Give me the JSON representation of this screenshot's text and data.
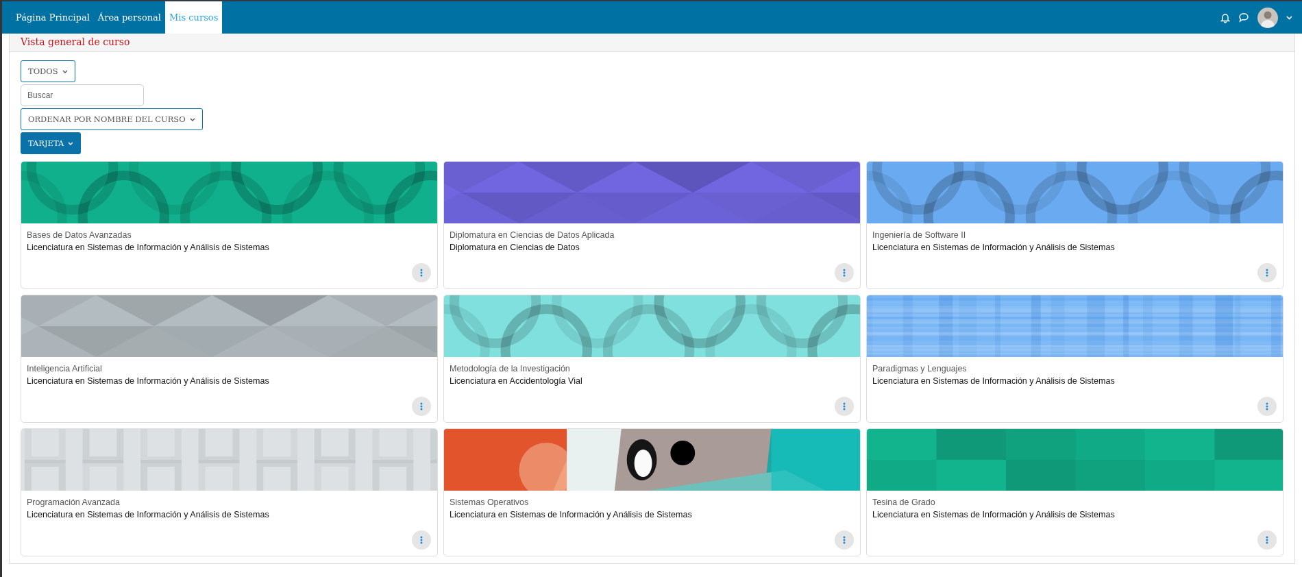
{
  "nav": {
    "links": [
      {
        "label": "Página Principal",
        "selected": false
      },
      {
        "label": "Área personal",
        "selected": false
      },
      {
        "label": "Mis cursos",
        "selected": true
      }
    ]
  },
  "page": {
    "heading": "Vista general de curso"
  },
  "filters": {
    "grouping": "TODOS",
    "search": {
      "placeholder": "Buscar"
    },
    "sort": "ORDENAR POR NOMBRE DEL CURSO",
    "view": "TARJETA"
  },
  "courses": [
    {
      "name": "Bases de Datos Avanzadas",
      "category": "Licenciatura en Sistemas de Información y Análisis de Sistemas",
      "banner": {
        "kind": "circles",
        "color": "#10b08c"
      }
    },
    {
      "name": "Diplomatura en Ciencias de Datos Aplicada",
      "category": "Diplomatura en Ciencias de Datos",
      "banner": {
        "kind": "triangles",
        "color": "#7166e0"
      }
    },
    {
      "name": "Ingeniería de Software II",
      "category": "Licenciatura en Sistemas de Información y Análisis de Sistemas",
      "banner": {
        "kind": "circles",
        "color": "#6aaaf0"
      }
    },
    {
      "name": "Inteligencia Artificial",
      "category": "Licenciatura en Sistemas de Información y Análisis de Sistemas",
      "banner": {
        "kind": "triangles",
        "color": "#b3bcc1"
      }
    },
    {
      "name": "Metodología de la Investigación",
      "category": "Licenciatura en Accidentología Vial",
      "banner": {
        "kind": "circles",
        "color": "#7fe0de"
      }
    },
    {
      "name": "Paradigmas y Lenguajes",
      "category": "Licenciatura en Sistemas de Información y Análisis de Sistemas",
      "banner": {
        "kind": "plaid",
        "color": "#6eb0f5"
      }
    },
    {
      "name": "Programación Avanzada",
      "category": "Licenciatura en Sistemas de Información y Análisis de Sistemas",
      "banner": {
        "kind": "squares",
        "color": "#dde1e3"
      }
    },
    {
      "name": "Sistemas Operativos",
      "category": "Licenciatura en Sistemas de Información y Análisis de Sistemas"
    },
    {
      "name": "Tesina de Grado",
      "category": "Licenciatura en Sistemas de Información y Análisis de Sistemas",
      "banner": {
        "kind": "tiles",
        "color": "#12b48e"
      }
    }
  ]
}
